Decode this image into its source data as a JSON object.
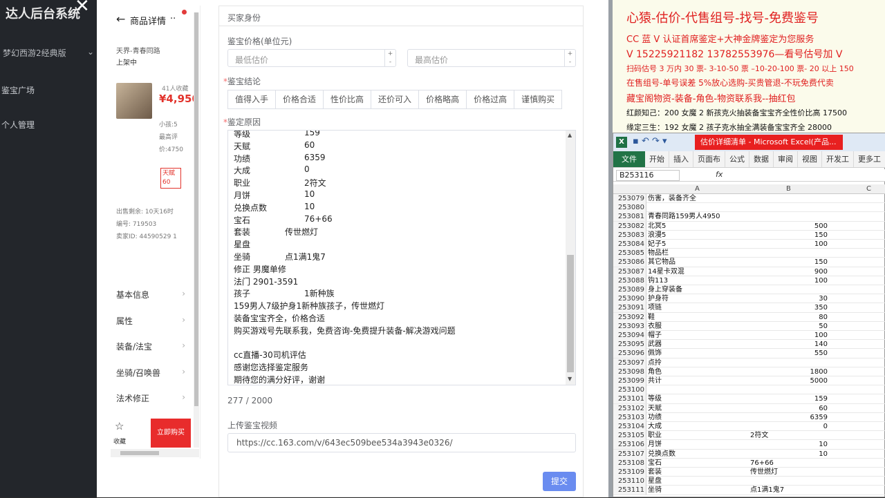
{
  "sidebar": {
    "brand": "达人后台系统",
    "version": "梦幻西游2经典版",
    "nav": [
      "鉴宝广场",
      "个人管理"
    ]
  },
  "phone": {
    "header_title": "商品详情",
    "server": "天界-青春同路",
    "status": "上架中",
    "favorites": "41人收藏",
    "price": "¥4,950",
    "child": "小孩:5",
    "highest_eval": "最高评价:4750",
    "tag": "天赋60",
    "sale_remaining_label": "出售剩余:",
    "sale_remaining_value": "10天16时",
    "code_label": "编号:",
    "code_value": "719503",
    "seller_id_label": "卖家ID:",
    "seller_id_value": "44590529 1",
    "menu": [
      "基本信息",
      "属性",
      "装备/法宝",
      "坐骑/召唤兽",
      "法术修正"
    ],
    "fav_label": "收藏",
    "buy_label": "立即购买"
  },
  "form": {
    "buyer_section": "买家身份",
    "price_label": "鉴宝价格(单位元)",
    "min_placeholder": "最低估价",
    "max_placeholder": "最高估价",
    "conclusion_label": "鉴宝结论",
    "conclusions": [
      "值得入手",
      "价格合适",
      "性价比高",
      "还价可入",
      "价格略高",
      "价格过高",
      "谨慎购买"
    ],
    "reason_label": "鉴定原因",
    "reason_lines": [
      {
        "k": "等级",
        "v": "159"
      },
      {
        "k": "天赋",
        "v": "60"
      },
      {
        "k": "功绩",
        "v": "6359"
      },
      {
        "k": "大成",
        "v": "0"
      },
      {
        "k": "职业",
        "v": "2符文"
      },
      {
        "k": "月饼",
        "v": "10"
      },
      {
        "k": "兑换点数",
        "v": "10"
      },
      {
        "k": "宝石",
        "v": "76+66"
      },
      {
        "k": "套装",
        "v": "传世燃灯"
      },
      {
        "k": "星盘",
        "v": ""
      },
      {
        "k": "坐骑",
        "v": "点1满1鬼7"
      },
      {
        "k": "修正 男魔单修",
        "v": ""
      },
      {
        "k": "法门 2901-3591",
        "v": ""
      },
      {
        "k": "孩子",
        "v": "1新种族"
      },
      {
        "k": "159男人7级护身1新种族孩子，传世燃灯",
        "v": ""
      },
      {
        "k": "装备宝宝齐全，价格合适",
        "v": ""
      },
      {
        "k": "购买游戏号先联系我，免费咨询-免费提升装备-解决游戏问题",
        "v": ""
      },
      {
        "k": "",
        "v": ""
      },
      {
        "k": "cc直播-30司机评估",
        "v": ""
      },
      {
        "k": "感谢您选择鉴定服务",
        "v": ""
      },
      {
        "k": "期待您的满分好评，谢谢",
        "v": ""
      }
    ],
    "char_count": "277 / 2000",
    "video_label": "上传鉴宝视频",
    "video_url": "https://cc.163.com/v/643ec509bee534a3943e0326/",
    "submit_label": "提交"
  },
  "promo": {
    "line1": "心猿-估价-代售组号-找号-免费鉴号",
    "line2": "CC 蓝 V 认证首席鉴定+大神金牌鉴定为您服务",
    "line3": "V 15225921182    13782553976—看号估号加 V",
    "line4": "扫码估号 3 万内 30 票- 3-10-50 票 –10-20-100 票- 20 以上 150",
    "line5": "在售组号-单号误差 5%放心选购-买贵管退-不玩免费代卖",
    "line6": "藏宝阁物资-装备-角色-物资联系我--抽红包",
    "line7": "红颜知己：200 女魔 2 新孩克火抽装备宝宝齐全性价比高 17500",
    "line8": "缘定三生：192 女魔 2 孩子克水抽全满装备宝宝齐全 28000"
  },
  "excel": {
    "doc_title": "估价详细清单 - Microsoft Excel(产品...",
    "tabs": [
      "开始",
      "插入",
      "页面布",
      "公式",
      "数据",
      "审阅",
      "视图",
      "开发工",
      "更多工"
    ],
    "file_tab": "文件",
    "name_box": "B253116",
    "fx": "fx",
    "col_a": "A",
    "col_b": "B",
    "col_c": "C",
    "rows": [
      {
        "n": "253079",
        "a": "伤害，装备齐全",
        "b": "",
        "bt": ""
      },
      {
        "n": "253080",
        "a": "",
        "b": "",
        "bt": ""
      },
      {
        "n": "253081",
        "a": "青春同路159男人4950",
        "b": "",
        "bt": ""
      },
      {
        "n": "253082",
        "a": "北冥5",
        "b": "500",
        "bt": ""
      },
      {
        "n": "253083",
        "a": "浪漫5",
        "b": "150",
        "bt": ""
      },
      {
        "n": "253084",
        "a": "妃子5",
        "b": "100",
        "bt": ""
      },
      {
        "n": "253085",
        "a": "物品栏",
        "b": "",
        "bt": ""
      },
      {
        "n": "253086",
        "a": "其它物品",
        "b": "150",
        "bt": ""
      },
      {
        "n": "253087",
        "a": "14星卡双混",
        "b": "900",
        "bt": ""
      },
      {
        "n": "253088",
        "a": "钩113",
        "b": "100",
        "bt": ""
      },
      {
        "n": "253089",
        "a": "身上穿装备",
        "b": "",
        "bt": ""
      },
      {
        "n": "253090",
        "a": "护身符",
        "b": "30",
        "bt": ""
      },
      {
        "n": "253091",
        "a": "项链",
        "b": "350",
        "bt": ""
      },
      {
        "n": "253092",
        "a": "鞋",
        "b": "80",
        "bt": ""
      },
      {
        "n": "253093",
        "a": "衣服",
        "b": "50",
        "bt": ""
      },
      {
        "n": "253094",
        "a": "帽子",
        "b": "100",
        "bt": ""
      },
      {
        "n": "253095",
        "a": "武器",
        "b": "140",
        "bt": ""
      },
      {
        "n": "253096",
        "a": "佩饰",
        "b": "550",
        "bt": ""
      },
      {
        "n": "253097",
        "a": "点拎",
        "b": "",
        "bt": ""
      },
      {
        "n": "253098",
        "a": "角色",
        "b": "1800",
        "bt": ""
      },
      {
        "n": "253099",
        "a": "共计",
        "b": "5000",
        "bt": ""
      },
      {
        "n": "253100",
        "a": "",
        "b": "",
        "bt": ""
      },
      {
        "n": "253101",
        "a": "等级",
        "b": "159",
        "bt": ""
      },
      {
        "n": "253102",
        "a": "天赋",
        "b": "60",
        "bt": ""
      },
      {
        "n": "253103",
        "a": "功绩",
        "b": "6359",
        "bt": ""
      },
      {
        "n": "253104",
        "a": "大成",
        "b": "0",
        "bt": ""
      },
      {
        "n": "253105",
        "a": "职业",
        "b": "",
        "bt": "2符文"
      },
      {
        "n": "253106",
        "a": "月饼",
        "b": "10",
        "bt": ""
      },
      {
        "n": "253107",
        "a": "兑换点数",
        "b": "10",
        "bt": ""
      },
      {
        "n": "253108",
        "a": "宝石",
        "b": "",
        "bt": "76+66"
      },
      {
        "n": "253109",
        "a": "套装",
        "b": "",
        "bt": "传世燃灯"
      },
      {
        "n": "253110",
        "a": "星盘",
        "b": "",
        "bt": ""
      },
      {
        "n": "253111",
        "a": "坐骑",
        "b": "",
        "bt": "点1满1鬼7"
      }
    ]
  }
}
